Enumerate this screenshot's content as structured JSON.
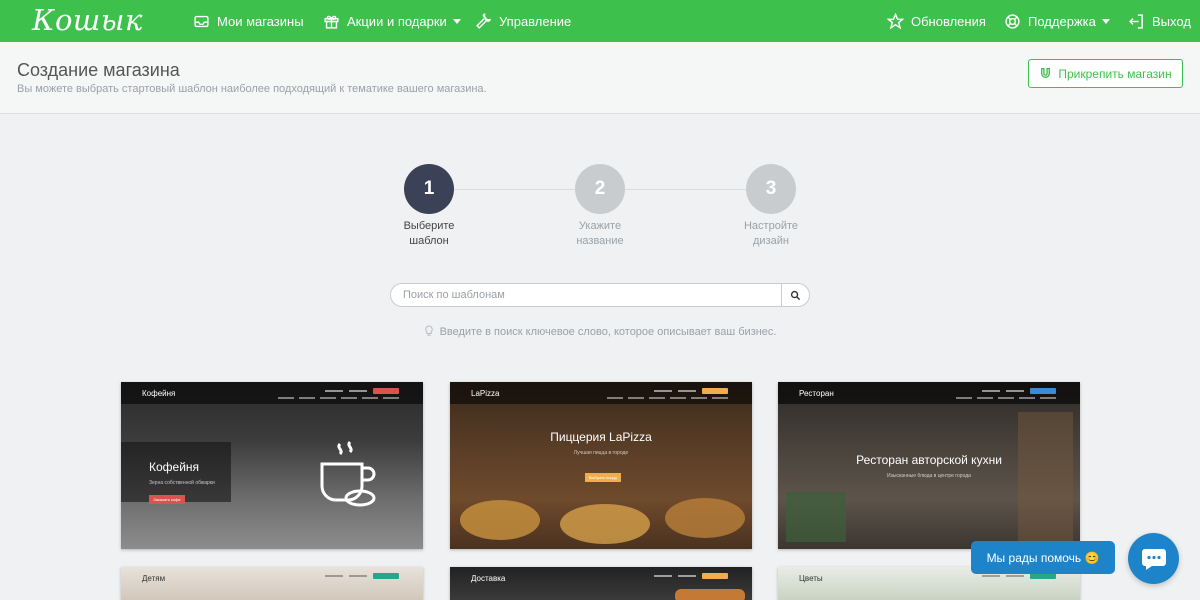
{
  "brand": {
    "logo_text": "Кошык",
    "accent": "#3ec04c",
    "help_color": "#1e84c9"
  },
  "nav": {
    "left": [
      {
        "label": "Мои магазины",
        "icon": "inbox-icon"
      },
      {
        "label": "Акции и подарки",
        "icon": "gift-icon",
        "dropdown": true
      },
      {
        "label": "Управление",
        "icon": "wrench-icon"
      }
    ],
    "right": [
      {
        "label": "Обновления",
        "icon": "star-icon"
      },
      {
        "label": "Поддержка",
        "icon": "lifebuoy-icon",
        "dropdown": true
      },
      {
        "label": "Выход",
        "icon": "logout-icon"
      }
    ]
  },
  "header": {
    "title": "Создание магазина",
    "subtitle": "Вы можете выбрать стартовый шаблон наиболее подходящий к тематике вашего магазина.",
    "attach_button": "Прикрепить магазин"
  },
  "steps": [
    {
      "number": "1",
      "line1": "Выберите",
      "line2": "шаблон",
      "active": true
    },
    {
      "number": "2",
      "line1": "Укажите",
      "line2": "название",
      "active": false
    },
    {
      "number": "3",
      "line1": "Настройте",
      "line2": "дизайн",
      "active": false
    }
  ],
  "search": {
    "placeholder": "Поиск по шаблонам",
    "value": "",
    "hint": "Введите в поиск ключевое слово, которое описывает ваш бизнес."
  },
  "templates": [
    {
      "title": "Кофейня",
      "headline": "Кофейня",
      "sub": "Зерна собственной обжарки",
      "button": "Заказать кофе"
    },
    {
      "title": "LaPizza",
      "headline": "Пиццерия LaPizza",
      "sub": "Лучшая пицца в городе",
      "button": "Выбрать пиццу"
    },
    {
      "title": "Ресторан",
      "headline": "Ресторан авторской кухни",
      "sub": "Изысканные блюда в центре города",
      "button": ""
    },
    {
      "title": "Детям",
      "headline": "",
      "sub": "",
      "button": ""
    },
    {
      "title": "Доставка",
      "headline": "",
      "sub": "",
      "button": ""
    },
    {
      "title": "Цветы",
      "headline": "",
      "sub": "",
      "button": ""
    }
  ],
  "help": {
    "label": "Мы рады помочь 😊"
  }
}
